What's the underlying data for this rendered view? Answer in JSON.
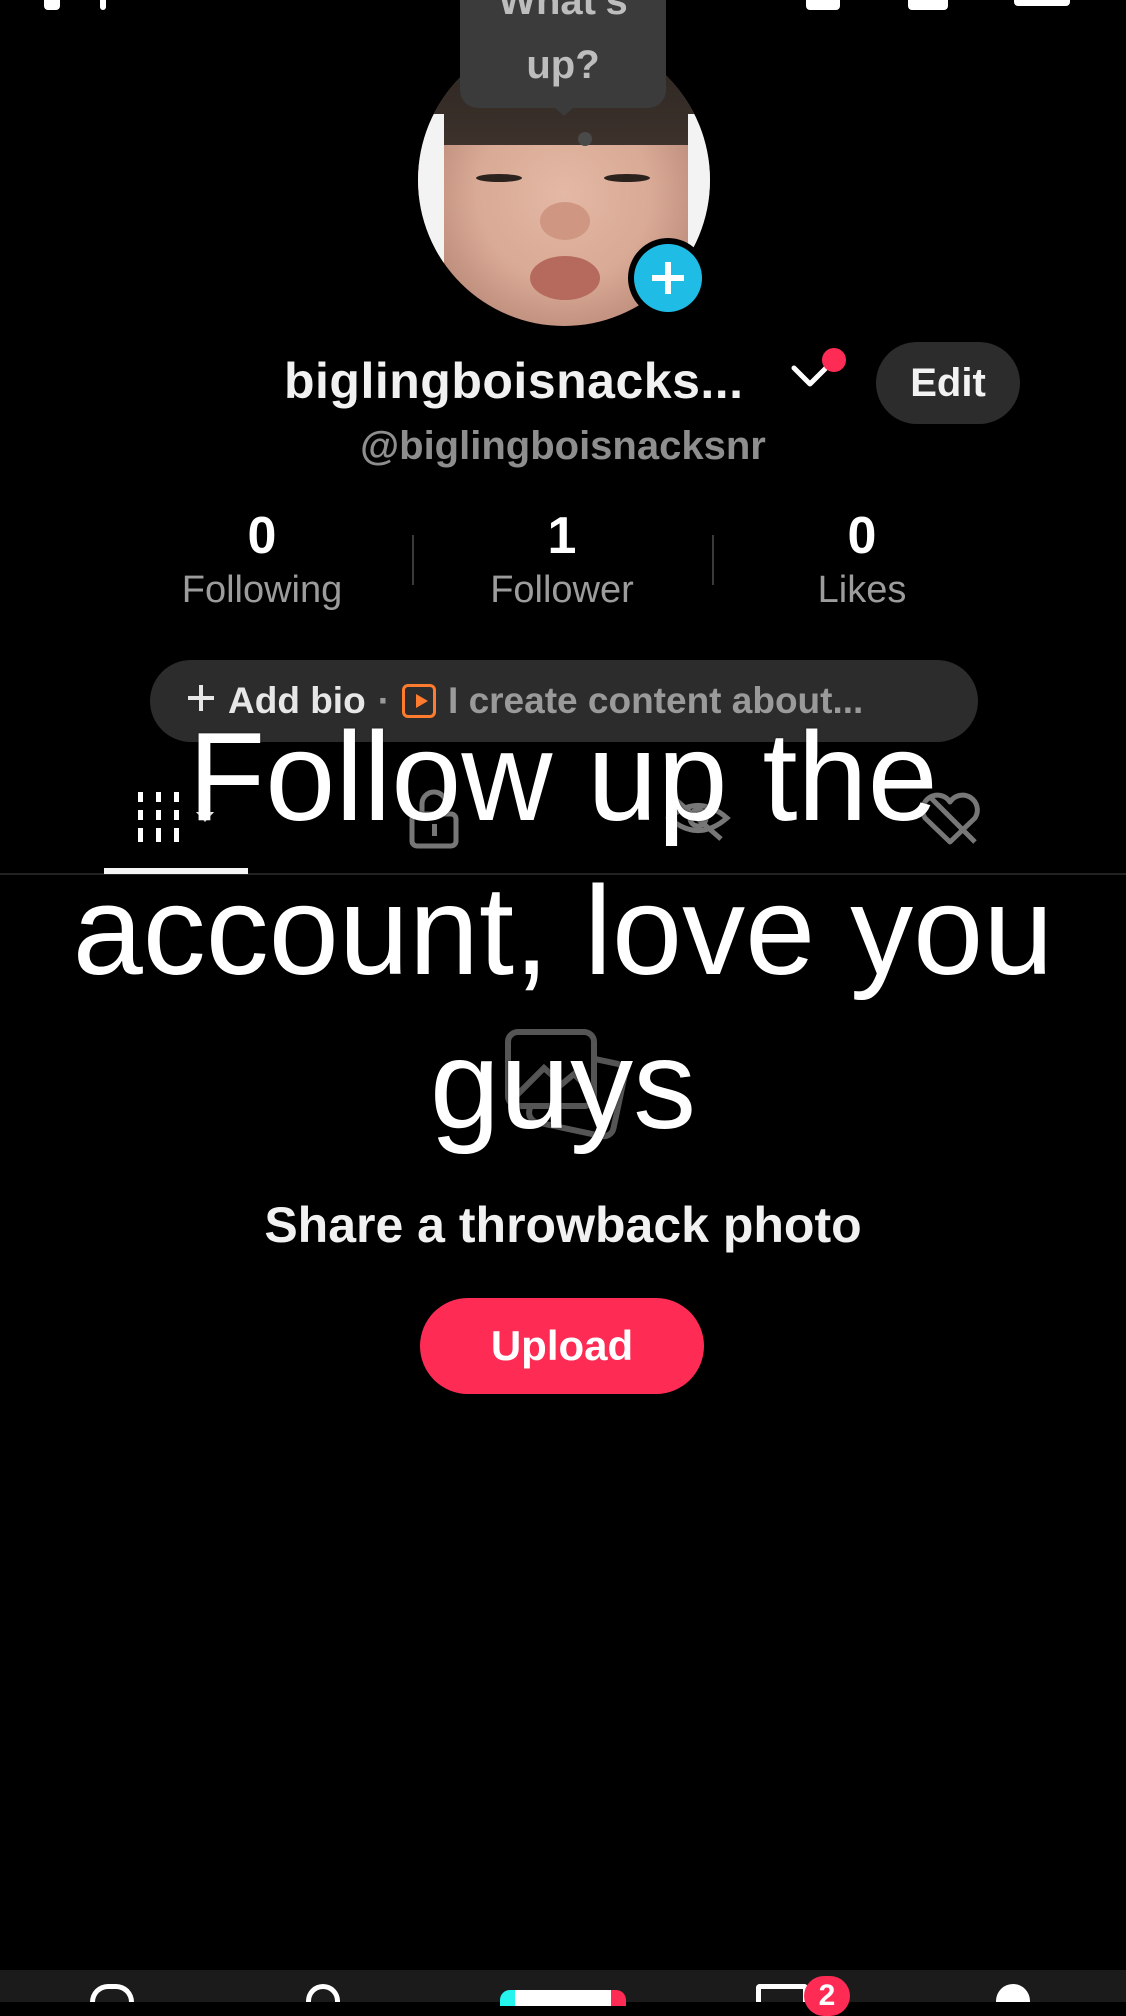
{
  "status_bar": {},
  "avatar": {
    "bubble_line1": "What's",
    "bubble_line2": "up?"
  },
  "profile": {
    "display_name": "biglingboisnacks...",
    "handle": "@biglingboisnacksnr",
    "edit_label": "Edit"
  },
  "stats": [
    {
      "value": "0",
      "label": "Following"
    },
    {
      "value": "1",
      "label": "Follower"
    },
    {
      "value": "0",
      "label": "Likes"
    }
  ],
  "bio": {
    "add_label": "Add bio",
    "separator": "·",
    "prompt": "I create content about..."
  },
  "tabs": [
    {
      "icon": "grid-icon",
      "selected": true
    },
    {
      "icon": "lock-icon",
      "selected": false
    },
    {
      "icon": "eye-slash-icon",
      "selected": false
    },
    {
      "icon": "heart-slash-icon",
      "selected": false
    }
  ],
  "empty_state": {
    "title": "Share a throwback photo",
    "upload_label": "Upload"
  },
  "overlay": {
    "caption": "Follow up the account, love you guys"
  },
  "bottom_nav": {
    "inbox_badge": "2"
  },
  "colors": {
    "background": "#000000",
    "accent": "#fe2c55",
    "avatar_add": "#1fbde6",
    "pill": "#2c2c2c"
  }
}
